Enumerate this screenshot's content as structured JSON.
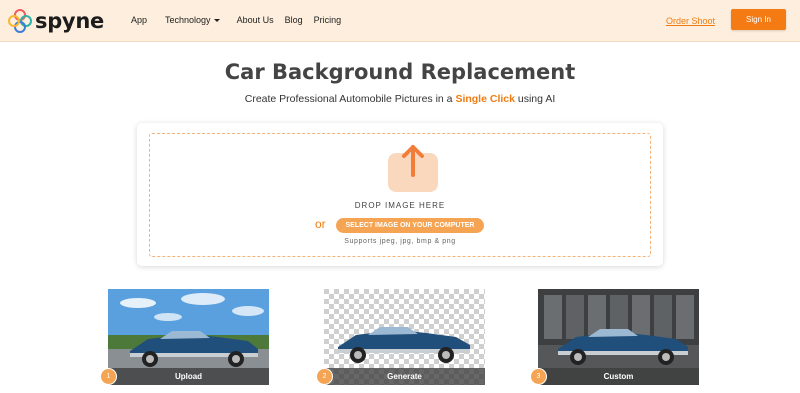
{
  "brand": {
    "name": "spyne",
    "logo_icon": "flower-logo-icon"
  },
  "nav": {
    "links": [
      "App",
      "Technology",
      "About Us",
      "Blog",
      "Pricing"
    ],
    "order_shoot": "Order Shoot",
    "sign_in": "Sign In"
  },
  "hero": {
    "title": "Car Background Replacement",
    "subtitle_pre": "Create Professional Automobile Pictures in a ",
    "subtitle_highlight": "Single Click",
    "subtitle_post": " using AI"
  },
  "upload": {
    "icon": "upload-arrow-icon",
    "drop_text": "DROP IMAGE HERE",
    "or": "or",
    "select_button": "SELECT IMAGE ON YOUR COMPUTER",
    "supports": "Supports jpeg, jpg, bmp & png"
  },
  "steps": [
    {
      "num": "1",
      "label": "Upload"
    },
    {
      "num": "2",
      "label": "Generate"
    },
    {
      "num": "3",
      "label": "Custom"
    }
  ],
  "colors": {
    "accent": "#f47a14",
    "nav_bg": "#fdeedd",
    "car": "#1f4f7a"
  }
}
